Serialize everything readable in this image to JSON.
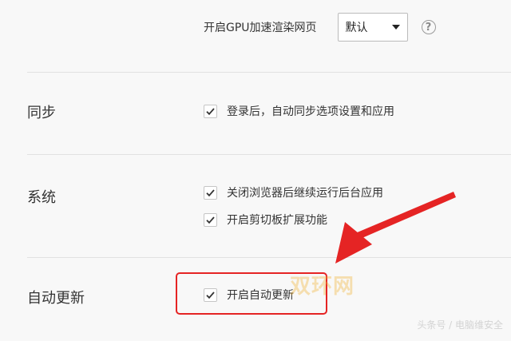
{
  "gpu": {
    "label": "开启GPU加速渲染网页",
    "select_value": "默认",
    "help_glyph": "?"
  },
  "sections": {
    "sync": {
      "title": "同步",
      "options": [
        {
          "label": "登录后，自动同步选项设置和应用",
          "checked": true
        }
      ]
    },
    "system": {
      "title": "系统",
      "options": [
        {
          "label": "关闭浏览器后继续运行后台应用",
          "checked": true
        },
        {
          "label": "开启剪切板扩展功能",
          "checked": true
        }
      ]
    },
    "autoupdate": {
      "title": "自动更新",
      "options": [
        {
          "label": "开启自动更新",
          "checked": true
        }
      ]
    }
  },
  "annotation": {
    "highlight_color": "#e52424",
    "arrow_color": "#e52424"
  },
  "watermark": {
    "main": "双环网",
    "sub": "头条号 / 电脑维安全"
  },
  "colors": {
    "background": "#f8f8f8",
    "check": "#333333",
    "divider": "#e2e2e2"
  }
}
